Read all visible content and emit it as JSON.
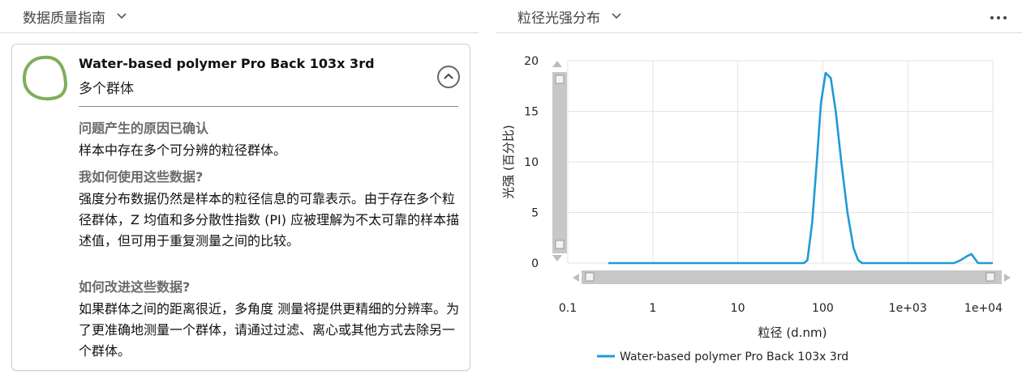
{
  "left_panel": {
    "header": {
      "title": "数据质量指南"
    },
    "card": {
      "title": "Water-based polymer Pro Back 103x 3rd",
      "subtitle": "多个群体",
      "sections": [
        {
          "heading": "问题产生的原因已确认",
          "body": "样本中存在多个可分辨的粒径群体。"
        },
        {
          "heading": "我如何使用这些数据?",
          "body": "强度分布数据仍然是样本的粒径信息的可靠表示。由于存在多个粒径群体，Z 均值和多分散性指数 (PI) 应被理解为不太可靠的样本描述值，但可用于重复测量之间的比较。"
        },
        {
          "heading": "如何改进这些数据?",
          "body": "如果群体之间的距离很近，多角度 测量将提供更精细的分辨率。为了更准确地测量一个群体，请通过过滤、离心或其他方式去除另一个群体。"
        }
      ],
      "status_color": "#7fae5a"
    }
  },
  "right_panel": {
    "header": {
      "title": "粒径光强分布"
    },
    "menu_icon": "more-horizontal-icon"
  },
  "chart_data": {
    "type": "line",
    "xlabel": "粒径 (d.nm)",
    "ylabel": "光强 (百分比)",
    "x_scale": "log",
    "xlim": [
      0.1,
      10000
    ],
    "ylim": [
      0,
      20
    ],
    "x_ticks": [
      0.1,
      1,
      10,
      100,
      1000,
      10000
    ],
    "x_tick_labels": [
      "0.1",
      "1",
      "10",
      "100",
      "1e+03",
      "1e+04"
    ],
    "y_ticks": [
      0,
      5,
      10,
      15,
      20
    ],
    "y_tick_labels": [
      "0",
      "5",
      "10",
      "15",
      "20"
    ],
    "grid": true,
    "legend_position": "bottom",
    "series": [
      {
        "name": "Water-based polymer Pro Back 103x 3rd",
        "color": "#1e9bd7",
        "points": [
          [
            0.3,
            0
          ],
          [
            60,
            0
          ],
          [
            66,
            0.3
          ],
          [
            75,
            4
          ],
          [
            85,
            10
          ],
          [
            95,
            15.8
          ],
          [
            108,
            18.8
          ],
          [
            124,
            18.3
          ],
          [
            142,
            15
          ],
          [
            165,
            10
          ],
          [
            195,
            5
          ],
          [
            230,
            1.5
          ],
          [
            260,
            0.3
          ],
          [
            290,
            0
          ],
          [
            3500,
            0
          ],
          [
            4200,
            0.3
          ],
          [
            5000,
            0.7
          ],
          [
            5600,
            0.9
          ],
          [
            6200,
            0.4
          ],
          [
            6700,
            0
          ],
          [
            10000,
            0
          ]
        ]
      }
    ]
  }
}
